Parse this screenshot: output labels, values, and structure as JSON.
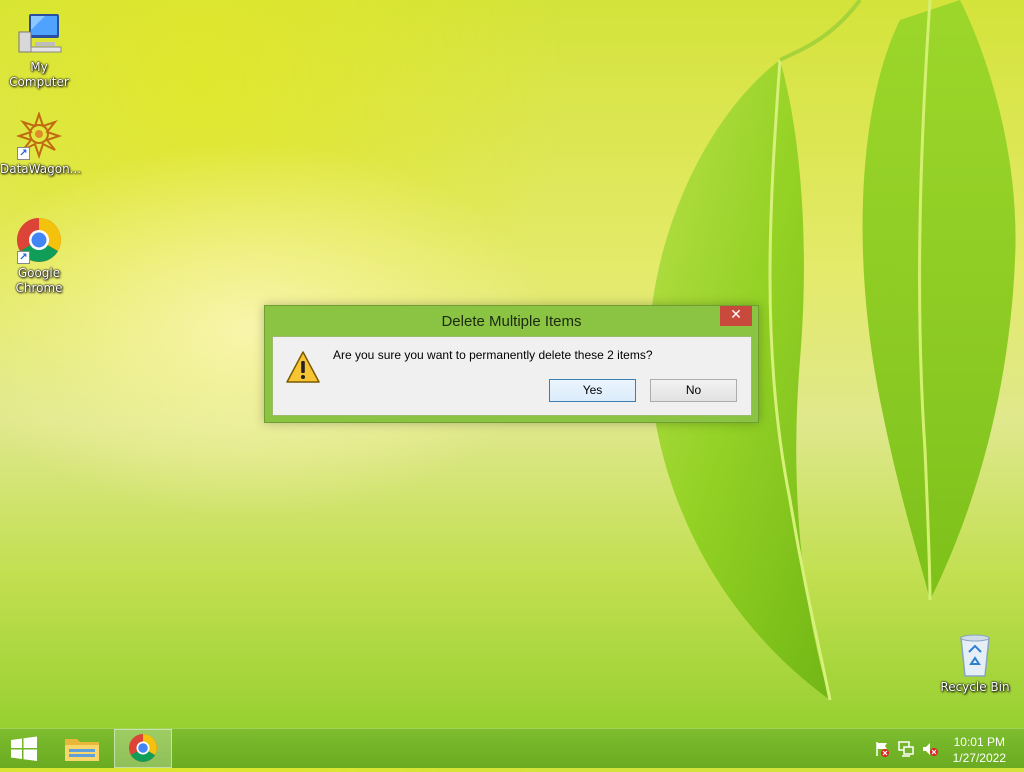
{
  "desktop": {
    "icons": [
      {
        "label": "My Computer"
      },
      {
        "label": "DataWagon..."
      },
      {
        "label": "Google Chrome"
      },
      {
        "label": "Recycle Bin"
      }
    ]
  },
  "dialog": {
    "title": "Delete Multiple Items",
    "close_glyph": "✕",
    "message": "Are you sure you want to permanently delete these 2 items?",
    "yes_label": "Yes",
    "no_label": "No",
    "icon": "warning-icon"
  },
  "taskbar": {
    "start_icon": "windows-logo-icon",
    "pinned": [
      {
        "icon": "file-explorer-icon"
      },
      {
        "icon": "chrome-icon",
        "active": true
      }
    ],
    "tray": [
      "action-center-flag-icon",
      "network-icon",
      "volume-muted-icon"
    ],
    "time": "10:01 PM",
    "date": "1/27/2022"
  },
  "colors": {
    "dialog_frame": "#8bc443",
    "taskbar": "#74b428",
    "close_button": "#c74a3c"
  }
}
